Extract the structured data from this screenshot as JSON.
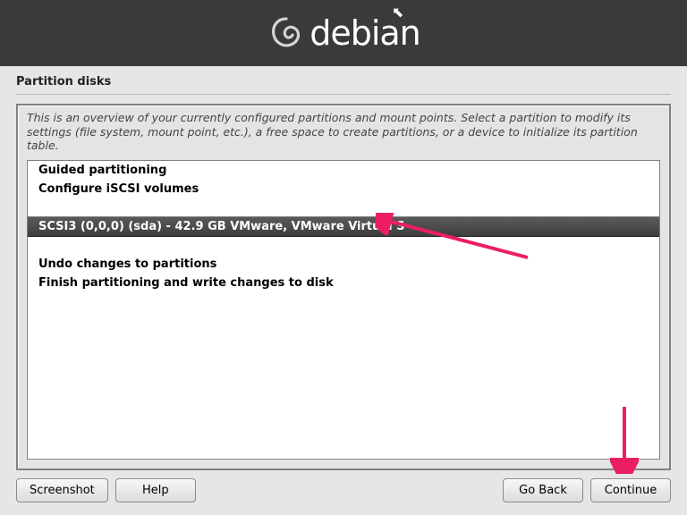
{
  "banner": {
    "brand_text": "debian"
  },
  "title": "Partition disks",
  "instructions": "This is an overview of your currently configured partitions and mount points. Select a partition to modify its settings (file system, mount point, etc.), a free space to create partitions, or a device to initialize its partition table.",
  "list": {
    "items": [
      {
        "label": "Guided partitioning",
        "selected": false,
        "spacer": false
      },
      {
        "label": "Configure iSCSI volumes",
        "selected": false,
        "spacer": false
      },
      {
        "label": "",
        "selected": false,
        "spacer": true
      },
      {
        "label": "SCSI3 (0,0,0) (sda) - 42.9 GB VMware, VMware Virtual S",
        "selected": true,
        "spacer": false
      },
      {
        "label": "",
        "selected": false,
        "spacer": true
      },
      {
        "label": "Undo changes to partitions",
        "selected": false,
        "spacer": false
      },
      {
        "label": "Finish partitioning and write changes to disk",
        "selected": false,
        "spacer": false
      }
    ]
  },
  "footer": {
    "left": [
      {
        "key": "screenshot",
        "label": "Screenshot"
      },
      {
        "key": "help",
        "label": "Help"
      }
    ],
    "right": [
      {
        "key": "goback",
        "label": "Go Back"
      },
      {
        "key": "continue",
        "label": "Continue"
      }
    ]
  },
  "colors": {
    "accent": "#ec1e62"
  }
}
